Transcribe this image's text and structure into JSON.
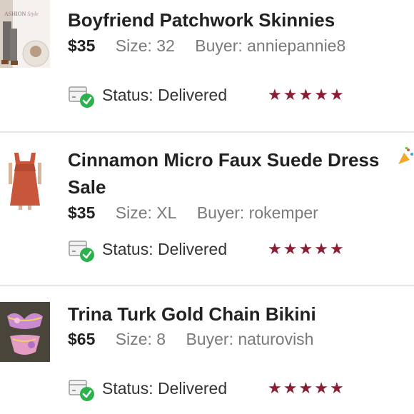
{
  "orders": [
    {
      "title": "Boyfriend Patchwork Skinnies",
      "price": "$35",
      "size": "Size: 32",
      "buyer": "Buyer: anniepannie8",
      "status": "Status: Delivered",
      "rating": 5,
      "thumb_text": "ASHION Style"
    },
    {
      "title": "Cinnamon Micro Faux Suede Dress Sale",
      "price": "$35",
      "size": "Size: XL",
      "buyer": "Buyer: rokemper",
      "status": "Status: Delivered",
      "rating": 5
    },
    {
      "title": "Trina Turk Gold Chain Bikini",
      "price": "$65",
      "size": "Size: 8",
      "buyer": "Buyer: naturovish",
      "status": "Status: Delivered",
      "rating": 5
    }
  ],
  "colors": {
    "star": "#8b1e34",
    "delivered_check": "#2bb24c",
    "divider": "#e6e6e6"
  },
  "icons": {
    "status": "package-delivered-icon",
    "rating": "star-icon",
    "emoji": "party-popper-icon"
  }
}
